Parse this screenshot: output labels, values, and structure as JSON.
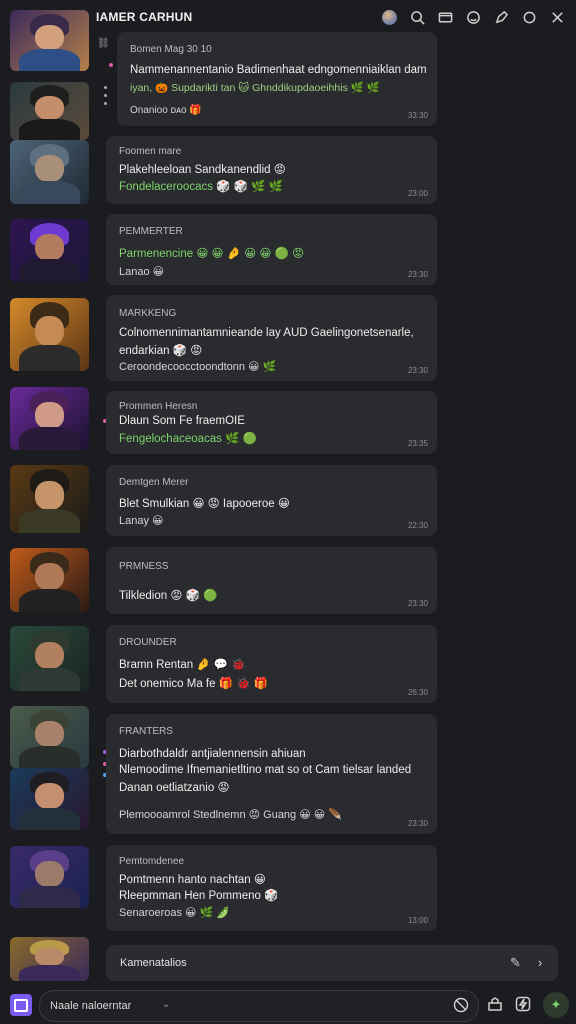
{
  "app": {
    "title": "IAMER CARHUN"
  },
  "messages": [
    {
      "header": "Bomen Mag 30 10",
      "lines": [
        "Nammenannentanio Badimenhaat edngomenniaiklan dam",
        "iyan, 🎃 Supdarikti tan 🐱 Ghnddikupdaoeihhis 🌿 🌿"
      ],
      "footer": "Onanioo ᴅᴀᴏ 🎁",
      "time": "33:30"
    },
    {
      "header": "Foomen mare",
      "lines": [
        "Plakehleeloan Sandkanendlid 😡",
        "Fondelaceroocacs 🎲 🎲 🌿 🌿"
      ],
      "footer": "",
      "time": "23:00"
    },
    {
      "header": "PEMMERTER",
      "lines": [
        "Parmenencine 😀 😀 🤌 😀 😀 🟢 😡",
        "Lanao 😀"
      ],
      "footer": "",
      "time": "23:30"
    },
    {
      "header": "MARKKENG",
      "lines": [
        "Colnomennimantamnieande lay AUD Gaelingonetsenarle,",
        "endarkian 🎲 😡"
      ],
      "footer": "Ceroondecoocctoondtonn 😀 🌿",
      "time": "23:30"
    },
    {
      "header": "Prommen Heresn",
      "lines": [
        "Dlaun Som Fe fraemOIE",
        "Fengelochaceoacas 🌿 🟢"
      ],
      "footer": "",
      "time": "23:35"
    },
    {
      "header": "Demtgen Merer",
      "lines": [
        "Blet Smulkian 😀 😡   Iapooeroe 😀",
        "Lanay 😀"
      ],
      "footer": "",
      "time": "22:30"
    },
    {
      "header": "PRMNESS",
      "lines": [
        "Tilkledion 😡 🎲 🟢"
      ],
      "footer": "",
      "time": "23:30"
    },
    {
      "header": "DROUNDER",
      "lines": [
        "Bramn Rentan 🤌 💬 🐞",
        "Det onemico Ma fe 🎁 🐞 🎁"
      ],
      "footer": "",
      "time": "26:30"
    },
    {
      "header": "FRANTERS",
      "lines": [
        "Diarbothdaldr antjialennensin ahiuan",
        "Nlemoodime Ifnemanietltino mat so ot Cam tielsar landed",
        "Danan oetliatzanio 😡"
      ],
      "footer": "Plemoooamrol Stedlnemn 😡 Guang 😀 😀 🪶",
      "time": "23:30"
    },
    {
      "header": "Pemtomdenee",
      "lines": [
        "Pomtmenn hanto nachtan 😀",
        "Rleepmman Hen Pommeno 🎲"
      ],
      "footer": "Senaroeroas 😀 🌿 🫛",
      "time": "13:00"
    }
  ],
  "last_item": {
    "label": "Kamenatalios"
  },
  "composer": {
    "placeholder": "Naale naloerntar"
  },
  "colors": {
    "accent": "#7a5cf0",
    "card": "#2a2b2f",
    "background": "#1b1c1f",
    "green_text": "#7fd36a"
  }
}
